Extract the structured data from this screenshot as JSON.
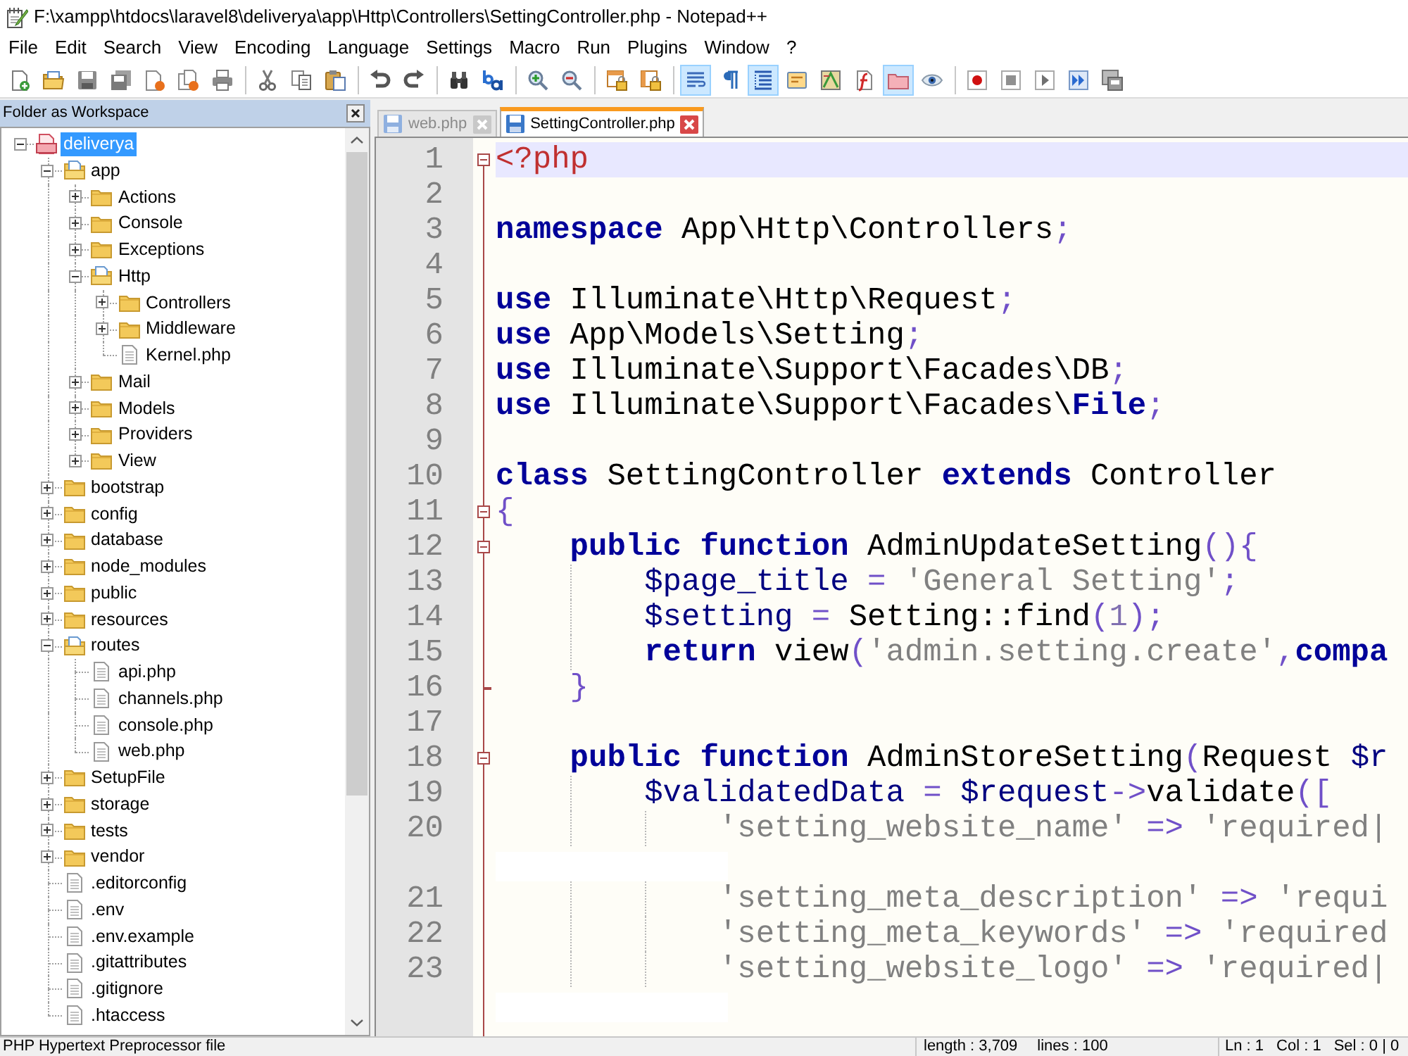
{
  "window": {
    "title": "F:\\xampp\\htdocs\\laravel8\\deliverya\\app\\Http\\Controllers\\SettingController.php - Notepad++"
  },
  "menu": [
    "File",
    "Edit",
    "Search",
    "View",
    "Encoding",
    "Language",
    "Settings",
    "Macro",
    "Run",
    "Plugins",
    "Window",
    "?"
  ],
  "toolbar": {
    "view_toggles": [
      {
        "pressed": true
      },
      {
        "pressed": false
      },
      {
        "pressed": true
      },
      {
        "pressed": false
      },
      {
        "pressed": false
      },
      {
        "pressed": false
      },
      {
        "pressed": true
      },
      {
        "pressed": false
      }
    ]
  },
  "sidebar": {
    "title": "Folder as Workspace",
    "tree": [
      {
        "label": "deliverya",
        "kind": "project",
        "expanded": true,
        "selected": true,
        "children": [
          {
            "label": "app",
            "kind": "folder",
            "expanded": true,
            "selected": false,
            "children": [
              {
                "label": "Actions",
                "kind": "folder",
                "expanded": false,
                "selected": false
              },
              {
                "label": "Console",
                "kind": "folder",
                "expanded": false,
                "selected": false
              },
              {
                "label": "Exceptions",
                "kind": "folder",
                "expanded": false,
                "selected": false
              },
              {
                "label": "Http",
                "kind": "folder",
                "expanded": true,
                "selected": false,
                "children": [
                  {
                    "label": "Controllers",
                    "kind": "folder",
                    "expanded": false,
                    "selected": false
                  },
                  {
                    "label": "Middleware",
                    "kind": "folder",
                    "expanded": false,
                    "selected": false
                  },
                  {
                    "label": "Kernel.php",
                    "kind": "file",
                    "selected": false
                  }
                ]
              },
              {
                "label": "Mail",
                "kind": "folder",
                "expanded": false,
                "selected": false
              },
              {
                "label": "Models",
                "kind": "folder",
                "expanded": false,
                "selected": false
              },
              {
                "label": "Providers",
                "kind": "folder",
                "expanded": false,
                "selected": false
              },
              {
                "label": "View",
                "kind": "folder",
                "expanded": false,
                "selected": false
              }
            ]
          },
          {
            "label": "bootstrap",
            "kind": "folder",
            "expanded": false,
            "selected": false
          },
          {
            "label": "config",
            "kind": "folder",
            "expanded": false,
            "selected": false
          },
          {
            "label": "database",
            "kind": "folder",
            "expanded": false,
            "selected": false
          },
          {
            "label": "node_modules",
            "kind": "folder",
            "expanded": false,
            "selected": false
          },
          {
            "label": "public",
            "kind": "folder",
            "expanded": false,
            "selected": false
          },
          {
            "label": "resources",
            "kind": "folder",
            "expanded": false,
            "selected": false
          },
          {
            "label": "routes",
            "kind": "folder",
            "expanded": true,
            "selected": false,
            "children": [
              {
                "label": "api.php",
                "kind": "file",
                "selected": false
              },
              {
                "label": "channels.php",
                "kind": "file",
                "selected": false
              },
              {
                "label": "console.php",
                "kind": "file",
                "selected": false
              },
              {
                "label": "web.php",
                "kind": "file",
                "selected": false
              }
            ]
          },
          {
            "label": "SetupFile",
            "kind": "folder",
            "expanded": false,
            "selected": false
          },
          {
            "label": "storage",
            "kind": "folder",
            "expanded": false,
            "selected": false
          },
          {
            "label": "tests",
            "kind": "folder",
            "expanded": false,
            "selected": false
          },
          {
            "label": "vendor",
            "kind": "folder",
            "expanded": false,
            "selected": false
          },
          {
            "label": ".editorconfig",
            "kind": "file",
            "selected": false
          },
          {
            "label": ".env",
            "kind": "file",
            "selected": false
          },
          {
            "label": ".env.example",
            "kind": "file",
            "selected": false
          },
          {
            "label": ".gitattributes",
            "kind": "file",
            "selected": false
          },
          {
            "label": ".gitignore",
            "kind": "file",
            "selected": false
          },
          {
            "label": ".htaccess",
            "kind": "file",
            "selected": false
          }
        ]
      }
    ]
  },
  "tabs": [
    {
      "label": "web.php",
      "selected": false
    },
    {
      "label": "SettingController.php",
      "selected": true
    }
  ],
  "editor": {
    "lines": [
      {
        "number": "1",
        "current": true,
        "wrapped": false,
        "fold_start": true,
        "fold_end": false,
        "tokens": [
          {
            "kind": "tag",
            "text": "<?php"
          }
        ]
      },
      {
        "number": "2",
        "current": false,
        "wrapped": false,
        "fold_start": false,
        "fold_end": false
      },
      {
        "number": "3",
        "current": false,
        "wrapped": false,
        "fold_start": false,
        "fold_end": false,
        "tokens": [
          {
            "kind": "keyword",
            "text": "namespace"
          },
          {
            "kind": "plain",
            "text": " App\\Http\\Controllers"
          },
          {
            "kind": "operator",
            "text": ";"
          }
        ]
      },
      {
        "number": "4",
        "current": false,
        "wrapped": false,
        "fold_start": false,
        "fold_end": false
      },
      {
        "number": "5",
        "current": false,
        "wrapped": false,
        "fold_start": false,
        "fold_end": false,
        "tokens": [
          {
            "kind": "keyword",
            "text": "use"
          },
          {
            "kind": "plain",
            "text": " Illuminate\\Http\\Request"
          },
          {
            "kind": "operator",
            "text": ";"
          }
        ]
      },
      {
        "number": "6",
        "current": false,
        "wrapped": false,
        "fold_start": false,
        "fold_end": false,
        "tokens": [
          {
            "kind": "keyword",
            "text": "use"
          },
          {
            "kind": "plain",
            "text": " App\\Models\\Setting"
          },
          {
            "kind": "operator",
            "text": ";"
          }
        ]
      },
      {
        "number": "7",
        "current": false,
        "wrapped": false,
        "fold_start": false,
        "fold_end": false,
        "tokens": [
          {
            "kind": "keyword",
            "text": "use"
          },
          {
            "kind": "plain",
            "text": " Illuminate\\Support\\Facades\\DB"
          },
          {
            "kind": "operator",
            "text": ";"
          }
        ]
      },
      {
        "number": "8",
        "current": false,
        "wrapped": false,
        "fold_start": false,
        "fold_end": false,
        "tokens": [
          {
            "kind": "keyword",
            "text": "use"
          },
          {
            "kind": "plain",
            "text": " Illuminate\\Support\\Facades\\"
          },
          {
            "kind": "keyword",
            "text": "File"
          },
          {
            "kind": "operator",
            "text": ";"
          }
        ]
      },
      {
        "number": "9",
        "current": false,
        "wrapped": false,
        "fold_start": false,
        "fold_end": false
      },
      {
        "number": "10",
        "current": false,
        "wrapped": false,
        "fold_start": false,
        "fold_end": false,
        "tokens": [
          {
            "kind": "keyword",
            "text": "class"
          },
          {
            "kind": "plain",
            "text": " SettingController "
          },
          {
            "kind": "keyword",
            "text": "extends"
          },
          {
            "kind": "plain",
            "text": " Controller"
          }
        ]
      },
      {
        "number": "11",
        "current": false,
        "wrapped": false,
        "fold_start": true,
        "fold_end": false,
        "tokens": [
          {
            "kind": "operator",
            "text": "{"
          }
        ]
      },
      {
        "number": "12",
        "current": false,
        "wrapped": false,
        "fold_start": true,
        "fold_end": false,
        "tokens": [
          {
            "kind": "keyword",
            "text": "    public"
          },
          {
            "kind": "keyword",
            "text": " function"
          },
          {
            "kind": "plain",
            "text": " AdminUpdateSetting"
          },
          {
            "kind": "operator",
            "text": "(){"
          }
        ]
      },
      {
        "number": "13",
        "current": false,
        "wrapped": false,
        "fold_start": false,
        "fold_end": false,
        "tokens": [
          {
            "kind": "variable",
            "text": "        $page_title"
          },
          {
            "kind": "operator",
            "text": " = "
          },
          {
            "kind": "string",
            "text": "'General Setting'"
          },
          {
            "kind": "operator",
            "text": ";"
          }
        ]
      },
      {
        "number": "14",
        "current": false,
        "wrapped": false,
        "fold_start": false,
        "fold_end": false,
        "tokens": [
          {
            "kind": "variable",
            "text": "        $setting"
          },
          {
            "kind": "operator",
            "text": " = "
          },
          {
            "kind": "plain",
            "text": "Setting::find"
          },
          {
            "kind": "operator",
            "text": "("
          },
          {
            "kind": "number",
            "text": "1"
          },
          {
            "kind": "operator",
            "text": ");"
          }
        ]
      },
      {
        "number": "15",
        "current": false,
        "wrapped": false,
        "fold_start": false,
        "fold_end": false,
        "tokens": [
          {
            "kind": "keyword",
            "text": "        return"
          },
          {
            "kind": "plain",
            "text": " view"
          },
          {
            "kind": "operator",
            "text": "("
          },
          {
            "kind": "string",
            "text": "'admin.setting.create'"
          },
          {
            "kind": "operator",
            "text": ","
          },
          {
            "kind": "keyword",
            "text": "compa"
          }
        ]
      },
      {
        "number": "16",
        "current": false,
        "wrapped": false,
        "fold_start": false,
        "fold_end": true,
        "tokens": [
          {
            "kind": "operator",
            "text": "    }"
          }
        ]
      },
      {
        "number": "17",
        "current": false,
        "wrapped": false,
        "fold_start": false,
        "fold_end": false
      },
      {
        "number": "18",
        "current": false,
        "wrapped": false,
        "fold_start": true,
        "fold_end": false,
        "tokens": [
          {
            "kind": "keyword",
            "text": "    public"
          },
          {
            "kind": "keyword",
            "text": " function"
          },
          {
            "kind": "plain",
            "text": " AdminStoreSetting"
          },
          {
            "kind": "operator",
            "text": "("
          },
          {
            "kind": "plain",
            "text": "Request "
          },
          {
            "kind": "variable",
            "text": "$r"
          }
        ]
      },
      {
        "number": "19",
        "current": false,
        "wrapped": false,
        "fold_start": false,
        "fold_end": false,
        "tokens": [
          {
            "kind": "variable",
            "text": "        $validatedData"
          },
          {
            "kind": "operator",
            "text": " = "
          },
          {
            "kind": "variable",
            "text": "$request"
          },
          {
            "kind": "operator",
            "text": "->"
          },
          {
            "kind": "plain",
            "text": "validate"
          },
          {
            "kind": "operator",
            "text": "(["
          }
        ]
      },
      {
        "number": "20",
        "current": false,
        "wrapped": true,
        "fold_start": false,
        "fold_end": false,
        "tokens": [
          {
            "kind": "string",
            "text": "            'setting_website_name'"
          },
          {
            "kind": "operator",
            "text": " => "
          },
          {
            "kind": "string",
            "text": "'required|"
          }
        ]
      },
      {
        "number": "21",
        "current": false,
        "wrapped": false,
        "fold_start": false,
        "fold_end": false,
        "tokens": [
          {
            "kind": "string",
            "text": "            'setting_meta_description'"
          },
          {
            "kind": "operator",
            "text": " => "
          },
          {
            "kind": "string",
            "text": "'requi"
          }
        ]
      },
      {
        "number": "22",
        "current": false,
        "wrapped": false,
        "fold_start": false,
        "fold_end": false,
        "tokens": [
          {
            "kind": "string",
            "text": "            'setting_meta_keywords'"
          },
          {
            "kind": "operator",
            "text": " => "
          },
          {
            "kind": "string",
            "text": "'required"
          }
        ]
      },
      {
        "number": "23",
        "current": false,
        "wrapped": true,
        "fold_start": false,
        "fold_end": false,
        "tokens": [
          {
            "kind": "string",
            "text": "            'setting_website_logo'"
          },
          {
            "kind": "operator",
            "text": " => "
          },
          {
            "kind": "string",
            "text": "'required|"
          }
        ]
      }
    ]
  },
  "status_bar": {
    "file_type": "PHP Hypertext Preprocessor file",
    "length": "length : 3,709",
    "lines": "lines : 100",
    "ln": "Ln : 1",
    "col": "Col : 1",
    "sel": "Sel : 0 | 0"
  }
}
